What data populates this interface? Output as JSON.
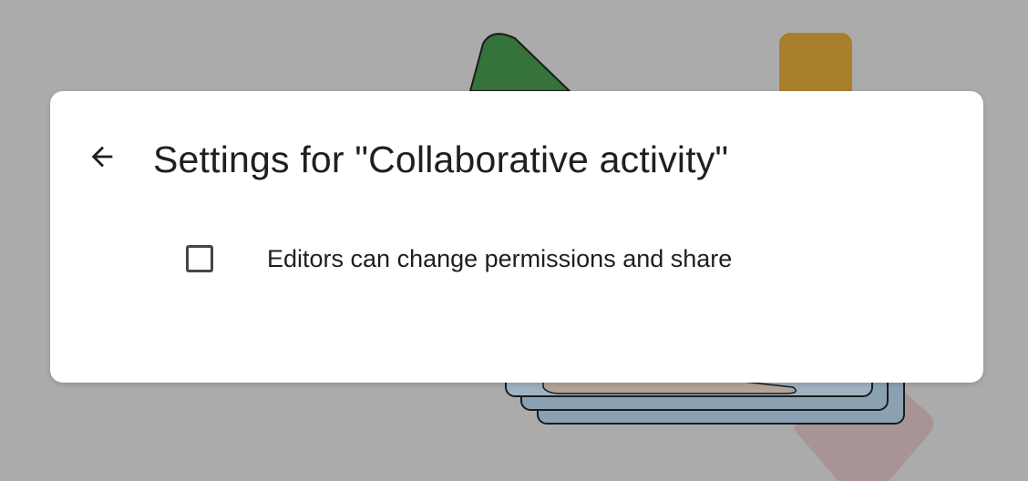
{
  "dialog": {
    "back_icon": "arrow-back-icon",
    "title": "Settings for \"Collaborative activity\"",
    "option": {
      "label": "Editors can change permissions and share",
      "checked": false
    }
  },
  "colors": {
    "overlay": "#ababab",
    "dialog_bg": "#ffffff",
    "text": "#1f1f1f",
    "checkbox_border": "#444746"
  }
}
